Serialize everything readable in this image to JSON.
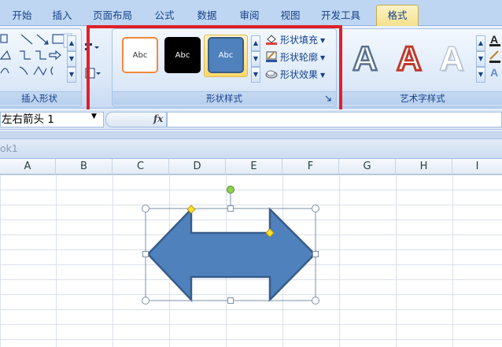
{
  "tabs": [
    {
      "label": "开始",
      "active": false
    },
    {
      "label": "插入",
      "active": false
    },
    {
      "label": "页面布局",
      "active": false
    },
    {
      "label": "公式",
      "active": false
    },
    {
      "label": "数据",
      "active": false
    },
    {
      "label": "审阅",
      "active": false
    },
    {
      "label": "视图",
      "active": false
    },
    {
      "label": "开发工具",
      "active": false
    },
    {
      "label": "格式",
      "active": true
    }
  ],
  "ribbon": {
    "insert_shapes": {
      "label": "插入形状"
    },
    "shape_styles": {
      "label": "形状样式",
      "presets": [
        {
          "text": "Abc",
          "fill": "#ffffff",
          "border": "#f08a3a",
          "text_color": "#333333"
        },
        {
          "text": "Abc",
          "fill": "#000000",
          "border": "#000000",
          "text_color": "#ffffff"
        },
        {
          "text": "Abc",
          "fill": "#4f81bd",
          "border": "#385d8a",
          "text_color": "#ffffff",
          "selected": true
        }
      ],
      "fill_label": "形状填充",
      "outline_label": "形状轮廓",
      "effects_label": "形状效果"
    },
    "wordart_styles": {
      "label": "艺术字样式",
      "samples": [
        "A",
        "A",
        "A"
      ]
    }
  },
  "formula_bar": {
    "name_box": "左右箭头 1",
    "fx": "fx",
    "formula": ""
  },
  "workbook": {
    "title": "ok1"
  },
  "columns": [
    "A",
    "B",
    "C",
    "D",
    "E",
    "F",
    "G",
    "H",
    "I"
  ],
  "shape": {
    "name": "left-right-arrow",
    "fill": "#4f81bd",
    "outline": "#385d8a"
  },
  "colors": {
    "accent_red": "#e0202a",
    "ribbon_bg": "#dbe8f8",
    "tab_active": "#f4e08a"
  }
}
